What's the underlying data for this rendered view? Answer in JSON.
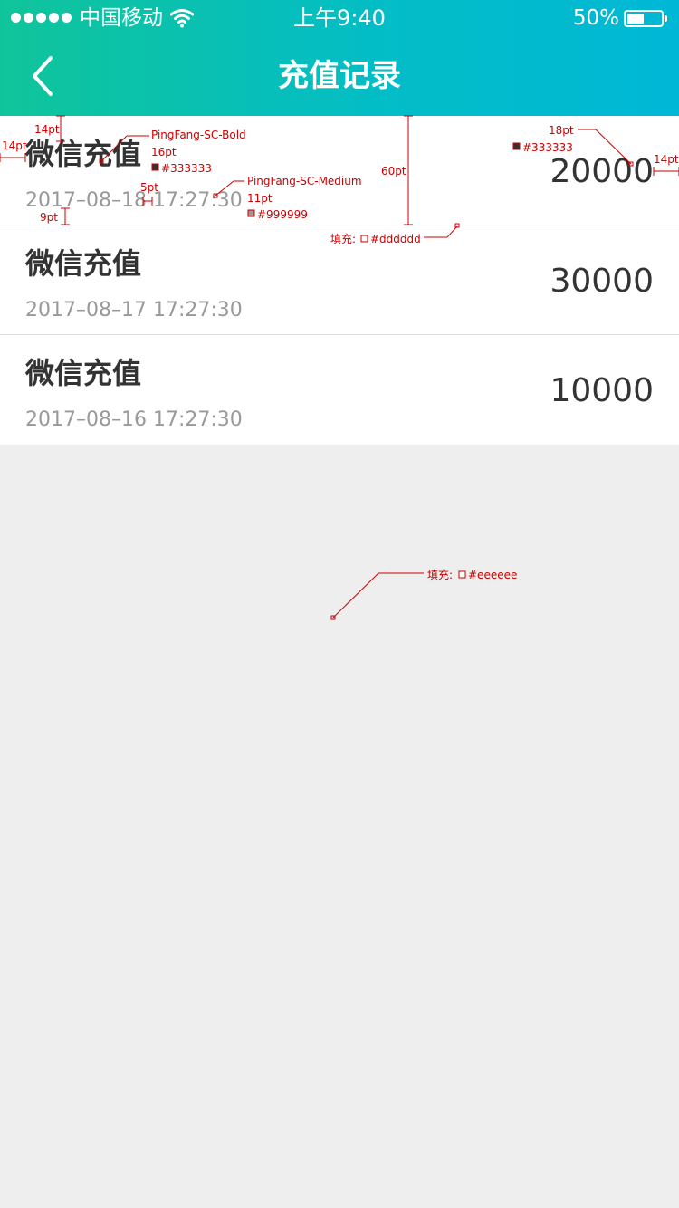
{
  "status_bar": {
    "carrier": "中国移动",
    "time": "上午9:40",
    "battery": "50%",
    "battery_level": 0.5,
    "signal_dots": 5
  },
  "nav": {
    "title": "充值记录",
    "back_icon": "chevron-left-icon"
  },
  "records": [
    {
      "title": "微信充值",
      "time": "2017–08–18 17:27:30",
      "amount": "20000"
    },
    {
      "title": "微信充值",
      "time": "2017–08–17 17:27:30",
      "amount": "30000"
    },
    {
      "title": "微信充值",
      "time": "2017–08–16 17:27:30",
      "amount": "10000"
    }
  ],
  "annotations": {
    "title_top": "14pt",
    "left_margin": "14pt",
    "title_font": "PingFang-SC-Bold",
    "title_size": "16pt",
    "title_color": "#333333",
    "gap": "5pt",
    "time_font": "PingFang-SC-Medium",
    "time_size": "11pt",
    "time_color": "#999999",
    "bottom_pad": "9pt",
    "row_height": "60pt",
    "divider_fill": "填充: ",
    "divider_color": "#dddddd",
    "amount_size": "18pt",
    "amount_color": "#333333",
    "right_margin": "14pt",
    "bg_fill": "填充: ",
    "bg_color": "#eeeeee"
  },
  "colors": {
    "gradient_start": "#10c49a",
    "gradient_end": "#00b8d6",
    "title": "#333333",
    "time": "#999999",
    "divider": "#dddddd",
    "background": "#eeeeee"
  }
}
